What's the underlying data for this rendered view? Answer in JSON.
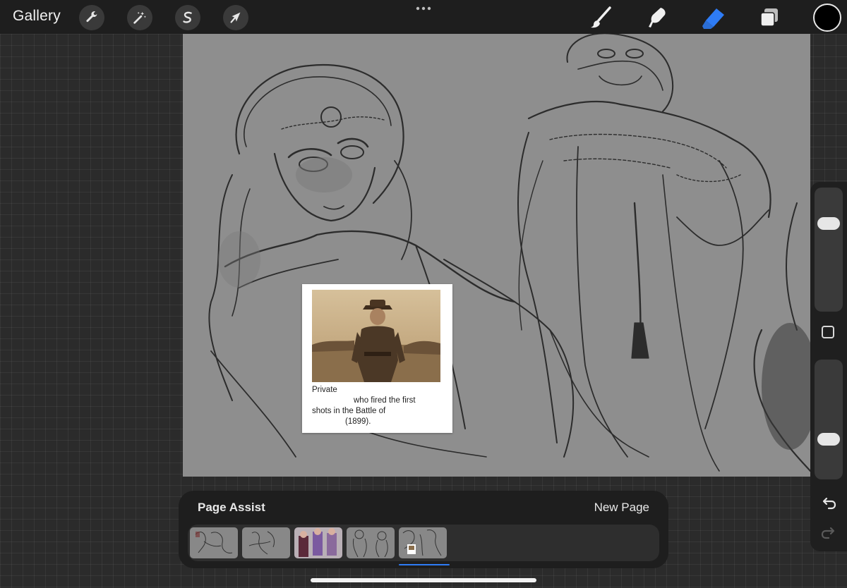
{
  "topbar": {
    "gallery_label": "Gallery",
    "left_tools": [
      "wrench-icon",
      "magic-wand-icon",
      "selection-s-icon",
      "transform-arrow-icon"
    ],
    "right_tools": [
      "brush-icon",
      "smudge-icon",
      "eraser-icon",
      "layers-icon"
    ],
    "active_tool": "eraser-icon",
    "current_color": "#000000",
    "accent_color": "#2e7cf6"
  },
  "canvas": {
    "background_color": "#8e8e8e",
    "reference_card": {
      "caption_lines": [
        "Private",
        "who fired the first",
        "shots in the Battle of",
        "(1899)."
      ]
    }
  },
  "side_panel": {
    "brush_size_label": "",
    "opacity_label": ""
  },
  "page_assist": {
    "title": "Page Assist",
    "new_page_label": "New Page",
    "page_count": 5,
    "selected_page": 5
  }
}
